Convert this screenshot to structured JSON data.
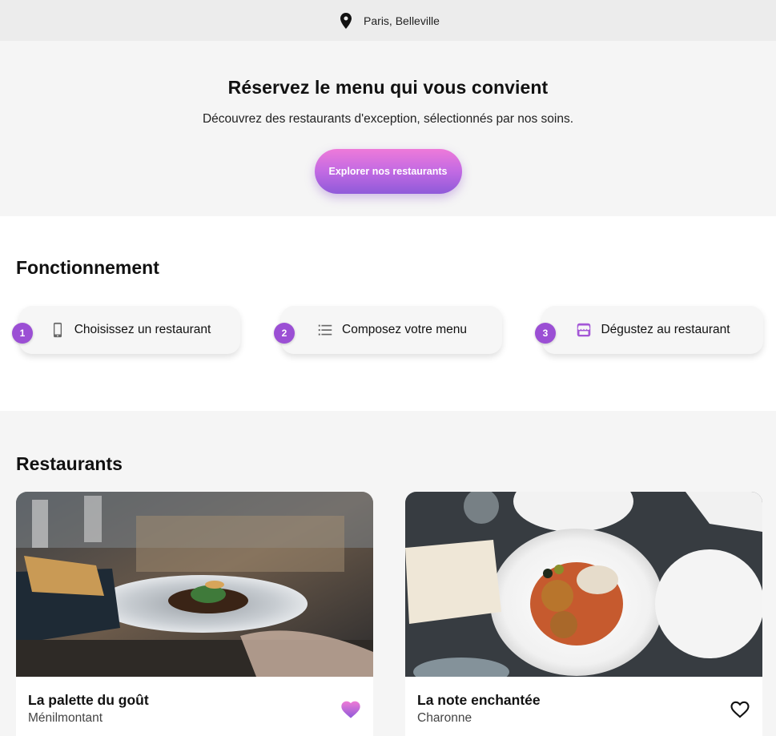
{
  "location": {
    "text": "Paris, Belleville",
    "icon": "map-pin-icon"
  },
  "hero": {
    "title": "Réservez le menu qui vous convient",
    "subtitle": "Découvrez des restaurants d'exception, sélectionnés par nos soins.",
    "cta_label": "Explorer nos restaurants"
  },
  "how": {
    "title": "Fonctionnement",
    "steps": [
      {
        "number": "1",
        "label": "Choisissez un restaurant",
        "icon": "smartphone-icon"
      },
      {
        "number": "2",
        "label": "Composez votre menu",
        "icon": "list-icon"
      },
      {
        "number": "3",
        "label": "Dégustez au restaurant",
        "icon": "store-icon"
      }
    ]
  },
  "restaurants": {
    "title": "Restaurants",
    "items": [
      {
        "name": "La palette du goût",
        "area": "Ménilmontant",
        "favorite": true
      },
      {
        "name": "La note enchantée",
        "area": "Charonne",
        "favorite": false
      }
    ]
  },
  "colors": {
    "accent": "#9b4fd4",
    "cta_gradient_top": "#ee7ad9",
    "cta_gradient_bottom": "#8f5ad9"
  }
}
